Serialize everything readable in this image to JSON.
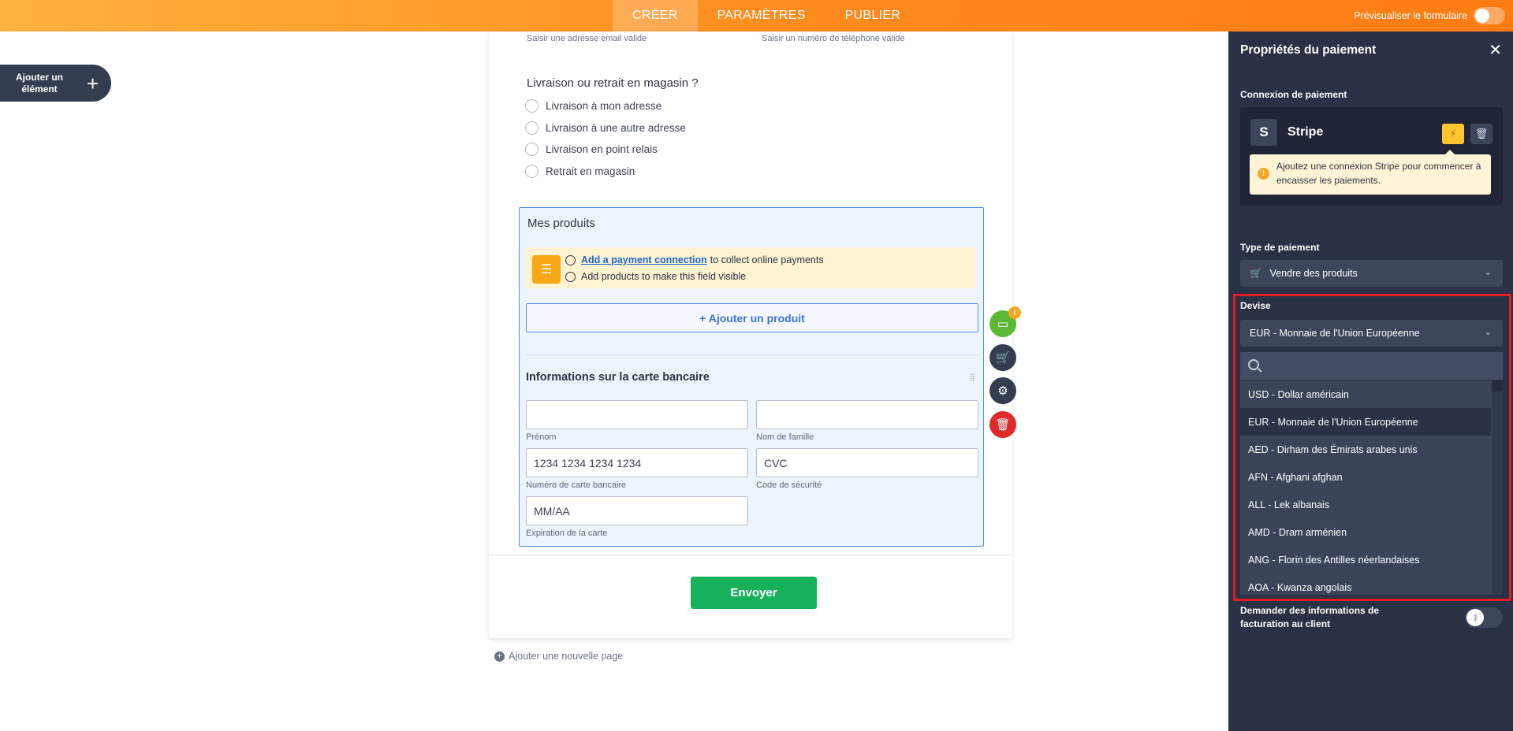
{
  "topbar": {
    "tabs": [
      {
        "label": "CRÉER",
        "active": true
      },
      {
        "label": "PARAMÈTRES",
        "active": false
      },
      {
        "label": "PUBLIER",
        "active": false
      }
    ],
    "preview_label": "Prévisualiser le formulaire"
  },
  "add_element": {
    "label": "Ajouter un élément"
  },
  "form": {
    "email_hint": "Saisir une adresse email valide",
    "phone_hint": "Saisir un numéro de téléphone valide",
    "delivery_question": "Livraison ou retrait en magasin ?",
    "delivery_options": [
      "Livraison à mon adresse",
      "Livraison à une autre adresse",
      "Livraison en point relais",
      "Retrait en magasin"
    ],
    "products": {
      "title": "Mes produits",
      "notice_link": "Add a payment connection",
      "notice_line1_rest": "to collect online payments",
      "notice_line2": "Add products to make this field visible",
      "add_product_label": "+ Ajouter un produit",
      "card_title": "Informations sur la carte bancaire",
      "fields": {
        "first_name_label": "Prénom",
        "last_name_label": "Nom de famille",
        "card_number_placeholder": "1234 1234 1234 1234",
        "card_number_label": "Numéro de carte bancaire",
        "cvc_placeholder": "CVC",
        "cvc_label": "Code de sécurité",
        "expiry_placeholder": "MM/AA",
        "expiry_label": "Expiration de la carte"
      }
    },
    "field_tools_badge": "!",
    "submit_label": "Envoyer",
    "add_page_label": "Ajouter une nouvelle page"
  },
  "panel": {
    "title": "Propriétés du paiement",
    "connection_section": "Connexion de paiement",
    "gateway_letter": "S",
    "gateway_name": "Stripe",
    "warning_text": "Ajoutez une connexion Stripe pour commencer à encaisser les paiements.",
    "warning_icon": "!",
    "payment_type_section": "Type de paiement",
    "payment_type_value": "Vendre des produits",
    "currency_section": "Devise",
    "currency_value": "EUR - Monnaie de l'Union Européenne",
    "currency_search_placeholder": "",
    "currency_options": [
      {
        "label": "USD - Dollar américain",
        "selected": false
      },
      {
        "label": "EUR - Monnaie de l'Union Européenne",
        "selected": true
      },
      {
        "label": "AED - Dirham des Émirats arabes unis",
        "selected": false
      },
      {
        "label": "AFN - Afghani afghan",
        "selected": false
      },
      {
        "label": "ALL - Lek albanais",
        "selected": false
      },
      {
        "label": "AMD - Dram arménien",
        "selected": false
      },
      {
        "label": "ANG - Florin des Antilles néerlandaises",
        "selected": false
      },
      {
        "label": "AOA - Kwanza angolais",
        "selected": false
      }
    ],
    "billing_label": "Demander des informations de facturation au client"
  },
  "colors": {
    "topbar_start": "#ffb23f",
    "topbar_end": "#ff7c12",
    "panel_bg": "#2a3145",
    "highlight": "#e11b22",
    "submit": "#18b15b",
    "selection_blue": "#4a8fe7"
  }
}
